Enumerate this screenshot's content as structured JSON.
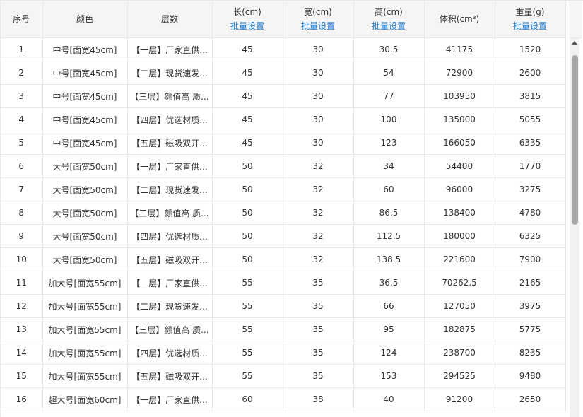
{
  "headers": {
    "index": "序号",
    "color": "颜色",
    "layers": "层数",
    "length": "长(cm)",
    "width": "宽(cm)",
    "height": "高(cm)",
    "volume": "体积(cm³)",
    "weight": "重量(g)",
    "batch_label": "批量设置"
  },
  "rows": [
    {
      "idx": "1",
      "color": "中号[面宽45cm]",
      "layer": "【一层】厂家直供...",
      "len": "45",
      "wid": "30",
      "hgt": "30.5",
      "vol": "41175",
      "wgt": "1520"
    },
    {
      "idx": "2",
      "color": "中号[面宽45cm]",
      "layer": "【二层】现货速发...",
      "len": "45",
      "wid": "30",
      "hgt": "54",
      "vol": "72900",
      "wgt": "2600"
    },
    {
      "idx": "3",
      "color": "中号[面宽45cm]",
      "layer": "【三层】颜值高 质...",
      "len": "45",
      "wid": "30",
      "hgt": "77",
      "vol": "103950",
      "wgt": "3815"
    },
    {
      "idx": "4",
      "color": "中号[面宽45cm]",
      "layer": "【四层】优选材质...",
      "len": "45",
      "wid": "30",
      "hgt": "100",
      "vol": "135000",
      "wgt": "5055"
    },
    {
      "idx": "5",
      "color": "中号[面宽45cm]",
      "layer": "【五层】磁吸双开...",
      "len": "45",
      "wid": "30",
      "hgt": "123",
      "vol": "166050",
      "wgt": "6335"
    },
    {
      "idx": "6",
      "color": "大号[面宽50cm]",
      "layer": "【一层】厂家直供...",
      "len": "50",
      "wid": "32",
      "hgt": "34",
      "vol": "54400",
      "wgt": "1770"
    },
    {
      "idx": "7",
      "color": "大号[面宽50cm]",
      "layer": "【二层】现货速发...",
      "len": "50",
      "wid": "32",
      "hgt": "60",
      "vol": "96000",
      "wgt": "3275"
    },
    {
      "idx": "8",
      "color": "大号[面宽50cm]",
      "layer": "【三层】颜值高 质...",
      "len": "50",
      "wid": "32",
      "hgt": "86.5",
      "vol": "138400",
      "wgt": "4780"
    },
    {
      "idx": "9",
      "color": "大号[面宽50cm]",
      "layer": "【四层】优选材质...",
      "len": "50",
      "wid": "32",
      "hgt": "112.5",
      "vol": "180000",
      "wgt": "6325"
    },
    {
      "idx": "10",
      "color": "大号[面宽50cm]",
      "layer": "【五层】磁吸双开...",
      "len": "50",
      "wid": "32",
      "hgt": "138.5",
      "vol": "221600",
      "wgt": "7900"
    },
    {
      "idx": "11",
      "color": "加大号[面宽55cm]",
      "layer": "【一层】厂家直供...",
      "len": "55",
      "wid": "35",
      "hgt": "36.5",
      "vol": "70262.5",
      "wgt": "2165"
    },
    {
      "idx": "12",
      "color": "加大号[面宽55cm]",
      "layer": "【二层】现货速发...",
      "len": "55",
      "wid": "35",
      "hgt": "66",
      "vol": "127050",
      "wgt": "3975"
    },
    {
      "idx": "13",
      "color": "加大号[面宽55cm]",
      "layer": "【三层】颜值高 质...",
      "len": "55",
      "wid": "35",
      "hgt": "95",
      "vol": "182875",
      "wgt": "5775"
    },
    {
      "idx": "14",
      "color": "加大号[面宽55cm]",
      "layer": "【四层】优选材质...",
      "len": "55",
      "wid": "35",
      "hgt": "124",
      "vol": "238700",
      "wgt": "8235"
    },
    {
      "idx": "15",
      "color": "加大号[面宽55cm]",
      "layer": "【五层】磁吸双开...",
      "len": "55",
      "wid": "35",
      "hgt": "153",
      "vol": "294525",
      "wgt": "9480"
    },
    {
      "idx": "16",
      "color": "超大号[面宽60cm]",
      "layer": "【一层】厂家直供...",
      "len": "60",
      "wid": "38",
      "hgt": "40",
      "vol": "91200",
      "wgt": "2650"
    }
  ],
  "colors": {
    "link": "#1d7ad2",
    "header_bg": "#f5f5f5",
    "border": "#e8e8e8",
    "scroll_thumb": "#a8a8a8"
  }
}
